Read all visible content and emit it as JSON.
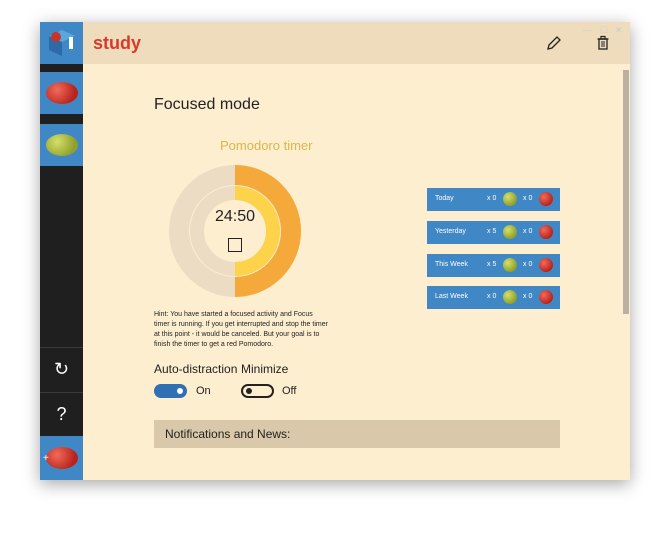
{
  "app": {
    "title": "study"
  },
  "window_controls": {
    "minimize": "—",
    "maximize": "☐",
    "close": "✕"
  },
  "main": {
    "mode_title": "Focused mode",
    "timer_title": "Pomodoro timer",
    "timer_value": "24:50",
    "timer_progress": 0.5,
    "hint": "Hint: You have started a focused activity and Focus timer is running. If you get interrupted and stop the timer at this point - it would be canceled. But your goal is to finish the timer to get a red Pomodoro.",
    "toggles": [
      {
        "label": "Auto-distraction",
        "state": "On",
        "on": true
      },
      {
        "label": "Minimize",
        "state": "Off",
        "on": false
      }
    ],
    "news_label": "Notifications and News:"
  },
  "stats": [
    {
      "label": "Today",
      "green_count": "x 0",
      "red_count": "x 0"
    },
    {
      "label": "Yesterday",
      "green_count": "x 5",
      "red_count": "x 0"
    },
    {
      "label": "This Week",
      "green_count": "x 5",
      "red_count": "x 0"
    },
    {
      "label": "Last Week",
      "green_count": "x 0",
      "red_count": "x 0"
    }
  ],
  "sidebar": {
    "help_glyph": "?",
    "refresh_glyph": "↻",
    "add_glyph": "+"
  },
  "colors": {
    "accent_blue": "#3f88c5",
    "title_red": "#d93a2a",
    "ring_orange": "#f4a93a",
    "ring_yellow": "#fcd34a",
    "panel": "#fdeed0"
  }
}
